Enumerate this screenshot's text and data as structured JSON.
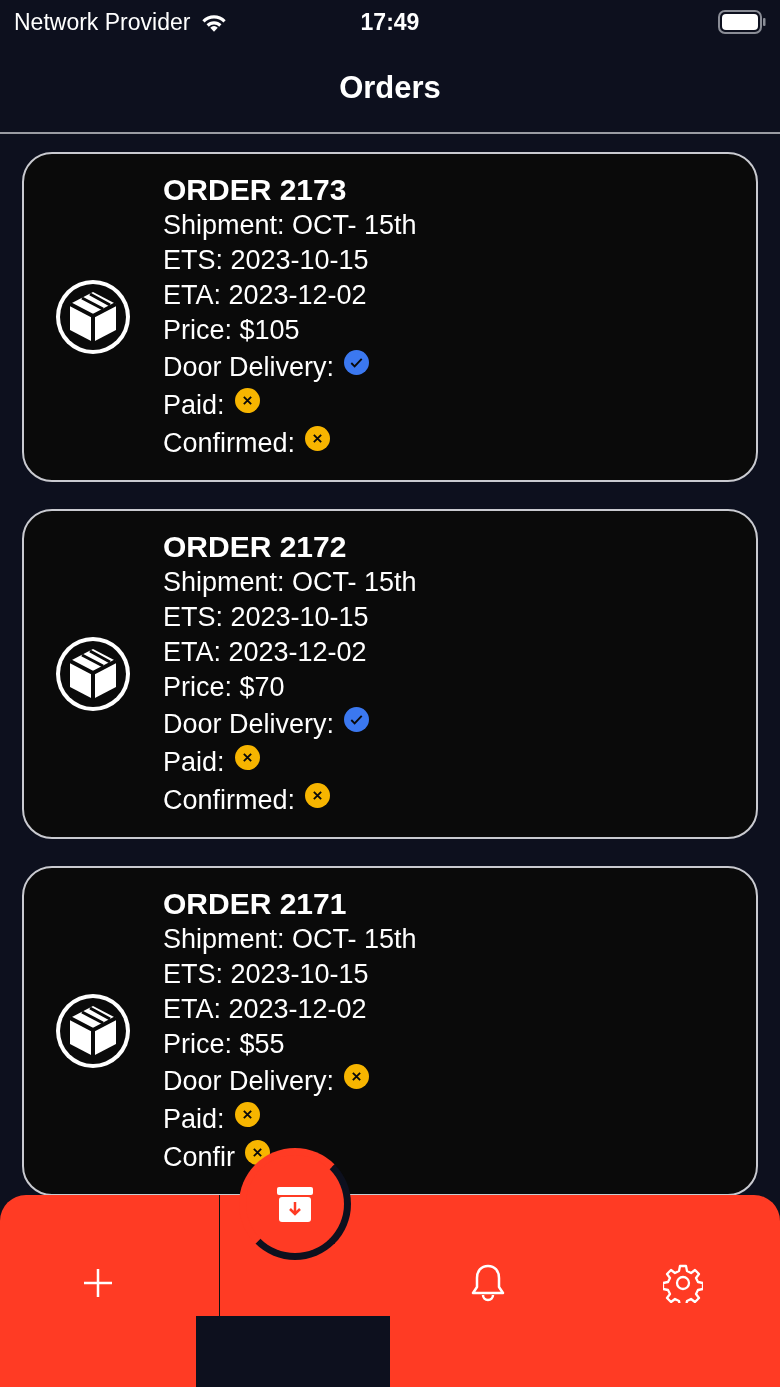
{
  "status_bar": {
    "carrier": "Network Provider",
    "time": "17:49"
  },
  "header": {
    "title": "Orders"
  },
  "orders": [
    {
      "title": "ORDER 2173",
      "lines": [
        "Shipment: OCT- 15th",
        "ETS: 2023-10-15",
        "ETA: 2023-12-02",
        "Price: $105"
      ],
      "flags": [
        {
          "label": "Door Delivery:",
          "checked": true
        },
        {
          "label": "Paid:",
          "checked": false
        },
        {
          "label": "Confirmed:",
          "checked": false
        }
      ]
    },
    {
      "title": "ORDER 2172",
      "lines": [
        "Shipment: OCT- 15th",
        "ETS: 2023-10-15",
        "ETA: 2023-12-02",
        "Price: $70"
      ],
      "flags": [
        {
          "label": "Door Delivery:",
          "checked": true
        },
        {
          "label": "Paid:",
          "checked": false
        },
        {
          "label": "Confirmed:",
          "checked": false
        }
      ]
    },
    {
      "title": "ORDER 2171",
      "lines": [
        "Shipment: OCT- 15th",
        "ETS: 2023-10-15",
        "ETA: 2023-12-02",
        "Price: $55"
      ],
      "flags": [
        {
          "label": "Door Delivery:",
          "checked": false
        },
        {
          "label": "Paid:",
          "checked": false
        },
        {
          "label": "Confir",
          "checked": false
        }
      ]
    }
  ],
  "tab_bar": {
    "items": [
      {
        "kind": "add"
      },
      {
        "kind": "spacer"
      },
      {
        "kind": "notifications"
      },
      {
        "kind": "settings"
      }
    ]
  }
}
